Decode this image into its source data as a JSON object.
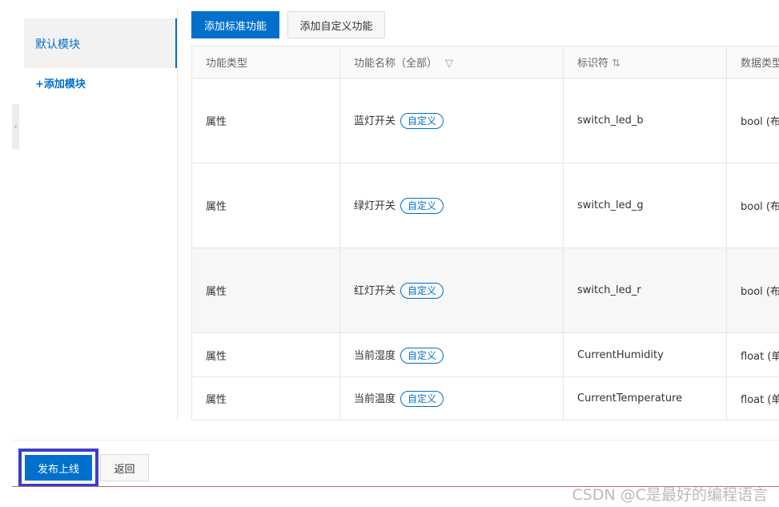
{
  "sidebar": {
    "default_module": "默认模块",
    "add_module": "+添加模块"
  },
  "toolbar": {
    "add_standard": "添加标准功能",
    "add_custom": "添加自定义功能"
  },
  "table": {
    "headers": [
      "功能类型",
      "功能名称（全部）",
      "标识符",
      "数据类型"
    ],
    "rows": [
      {
        "type": "属性",
        "name": "蓝灯开关",
        "tag": "自定义",
        "identifier": "switch_led_b",
        "data_type": "bool (布"
      },
      {
        "type": "属性",
        "name": "绿灯开关",
        "tag": "自定义",
        "identifier": "switch_led_g",
        "data_type": "bool (布"
      },
      {
        "type": "属性",
        "name": "红灯开关",
        "tag": "自定义",
        "identifier": "switch_led_r",
        "data_type": "bool (布"
      },
      {
        "type": "属性",
        "name": "当前湿度",
        "tag": "自定义",
        "identifier": "CurrentHumidity",
        "data_type": "float (单"
      },
      {
        "type": "属性",
        "name": "当前温度",
        "tag": "自定义",
        "identifier": "CurrentTemperature",
        "data_type": "float (单"
      }
    ]
  },
  "footer": {
    "publish": "发布上线",
    "back": "返回"
  },
  "watermark": "CSDN @C是最好的编程语言",
  "colors": {
    "accent": "#0070cc",
    "highlight_box": "#3a3ec8"
  }
}
